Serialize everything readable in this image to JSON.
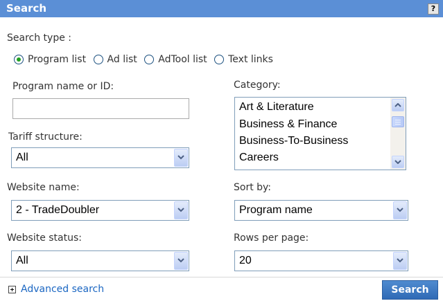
{
  "header": {
    "title": "Search",
    "help_label": "?"
  },
  "search_type": {
    "label": "Search type :",
    "options": [
      {
        "label": "Program list",
        "checked": true
      },
      {
        "label": "Ad list",
        "checked": false
      },
      {
        "label": "AdTool list",
        "checked": false
      },
      {
        "label": "Text links",
        "checked": false
      }
    ]
  },
  "program_name": {
    "label": "Program name or ID:",
    "value": "",
    "placeholder": ""
  },
  "category": {
    "label": "Category:",
    "items": [
      "Art & Literature",
      "Business & Finance",
      "Business-To-Business",
      "Careers"
    ]
  },
  "tariff_structure": {
    "label": "Tariff structure:",
    "value": "All"
  },
  "website_name": {
    "label": "Website name:",
    "value": "2 - TradeDoubler"
  },
  "sort_by": {
    "label": "Sort by:",
    "value": "Program name"
  },
  "website_status": {
    "label": "Website status:",
    "value": "All"
  },
  "rows_per_page": {
    "label": "Rows per page:",
    "value": "20"
  },
  "footer": {
    "advanced_search": "Advanced search",
    "search_button": "Search"
  },
  "colors": {
    "header_bg": "#5b8fd6",
    "link": "#1a66c2",
    "button_bg": "#3a76c0"
  }
}
